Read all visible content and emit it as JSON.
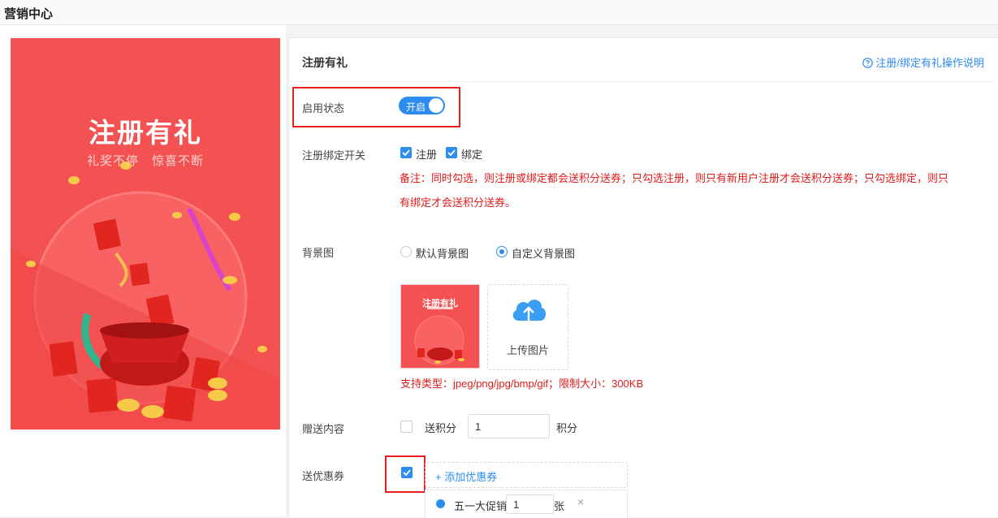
{
  "app": {
    "title": "营销中心"
  },
  "poster": {
    "title": "注册有礼",
    "subtitle": "礼奖不停　惊喜不断"
  },
  "panel": {
    "title": "注册有礼",
    "help_link": "注册/绑定有礼操作说明"
  },
  "status": {
    "label": "启用状态",
    "toggle_text": "开启",
    "enabled": true
  },
  "bind_switch": {
    "label": "注册绑定开关",
    "options": [
      {
        "label": "注册",
        "checked": true
      },
      {
        "label": "绑定",
        "checked": true
      }
    ],
    "note_line1": "备注：同时勾选，则注册或绑定都会送积分送券；只勾选注册，则只有新用户注册才会送积分送券；只勾选绑定，则只",
    "note_line2": "有绑定才会送积分送券。"
  },
  "background": {
    "label": "背景图",
    "options": [
      {
        "label": "默认背景图",
        "selected": false
      },
      {
        "label": "自定义背景图",
        "selected": true
      }
    ],
    "thumb_title": "注册有礼",
    "upload_label": "上传图片",
    "tips": "支持类型：jpeg/png/jpg/bmp/gif；限制大小：300KB"
  },
  "gift": {
    "label": "赠送内容",
    "points_label": "送积分",
    "points_value": "1",
    "points_unit": "积分",
    "points_checked": false
  },
  "coupon": {
    "label": "送优惠券",
    "checked": true,
    "add_label": "+ 添加优惠券",
    "items": [
      {
        "name": "五一大促销",
        "qty": "1",
        "unit": "张"
      }
    ]
  },
  "colors": {
    "accent": "#2d8cf0",
    "alert": "#e01a1a",
    "poster_bg": "#f45252"
  }
}
